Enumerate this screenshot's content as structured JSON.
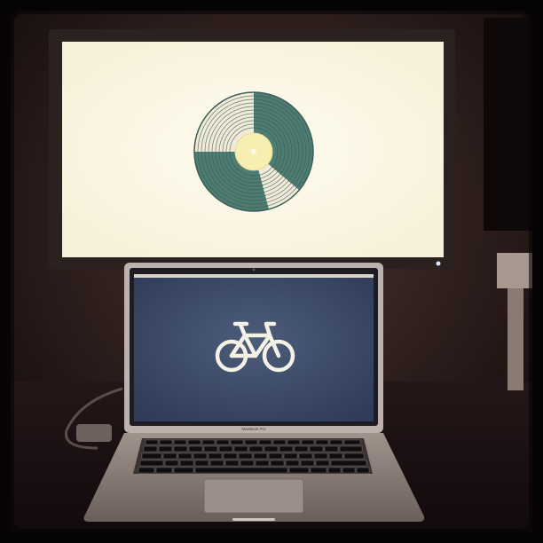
{
  "laptop": {
    "brand_label": "MacBook Pro"
  },
  "colors": {
    "room_dark": "#2a1c1a",
    "monitor_screen": "#fffbe9",
    "monitor_bezel": "#2b2220",
    "vinyl_teal": "#4f7c72",
    "vinyl_cream": "#f1ead8",
    "vinyl_label": "#f7efb2",
    "laptop_screen": "#3f4f6c",
    "bicycle_icon": "#f4f2e4",
    "laptop_body": "#8a7c76"
  },
  "icons": {
    "monitor_graphic": "vinyl-record-icon",
    "laptop_graphic": "bicycle-icon"
  }
}
